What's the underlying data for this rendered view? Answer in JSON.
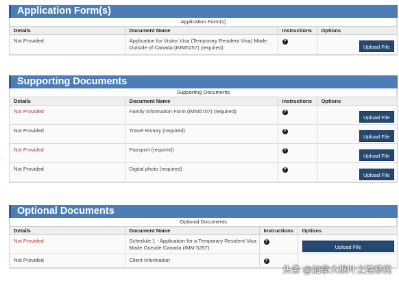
{
  "sections": [
    {
      "header": "Application Form(s)",
      "caption": "Application Form(s)",
      "columns": [
        "Details",
        "Document Name",
        "Instructions",
        "Options"
      ],
      "rows": [
        {
          "details": "Not Provided",
          "details_red": false,
          "document": "Application for Visitor Visa (Temporary Resident Visa) Made Outside of Canada (IMM5257)  (required)",
          "button": "Upload File"
        }
      ]
    },
    {
      "header": "Supporting Documents",
      "caption": "Supporting Documents",
      "columns": [
        "Details",
        "Document Name",
        "Instructions",
        "Options"
      ],
      "rows": [
        {
          "details": "Not Provided",
          "details_red": true,
          "document": "Family Information Form (IMM5707)  (required)",
          "button": "Upload File"
        },
        {
          "details": "Not Provided",
          "details_red": false,
          "document": "Travel History  (required)",
          "button": "Upload File"
        },
        {
          "details": "Not Provided",
          "details_red": true,
          "document": "Passport  (required)",
          "button": "Upload File"
        },
        {
          "details": "Not Provided",
          "details_red": false,
          "document": "Digital photo  (required)",
          "button": "Upload File"
        }
      ]
    },
    {
      "header": "Optional Documents",
      "caption": "Optional Documents",
      "columns": [
        "Details",
        "Document Name",
        "Instructions",
        "Options"
      ],
      "rows": [
        {
          "details": "Not Provided",
          "details_red": true,
          "document": "Schedule 1 - Application for a Temporary Resident Visa Made Outside Canada (IMM 5257)",
          "button": "Upload File"
        },
        {
          "details": "Not Provided",
          "details_red": false,
          "document": "Client Information",
          "button": ""
        }
      ]
    }
  ],
  "help_icon_glyph": "?",
  "watermark": "头条 @加拿大枫叶之路移民",
  "colors": {
    "header_bg": "#4d7db6",
    "button_bg": "#24486f",
    "red_text": "#a94236"
  }
}
